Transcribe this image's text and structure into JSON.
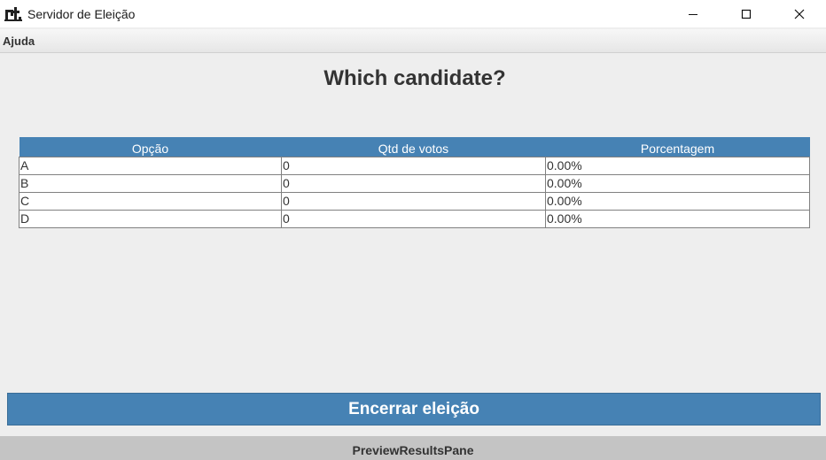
{
  "window": {
    "title": "Servidor de Eleição",
    "icon": "app-icon",
    "controls": [
      "minimize-icon",
      "maximize-icon",
      "close-icon"
    ]
  },
  "menu": {
    "items": [
      {
        "label": "Ajuda"
      }
    ]
  },
  "heading": "Which candidate?",
  "table": {
    "headers": [
      "Opção",
      "Qtd de votos",
      "Porcentagem"
    ],
    "rows": [
      {
        "option": "A",
        "votes": "0",
        "percent": "0.00%"
      },
      {
        "option": "B",
        "votes": "0",
        "percent": "0.00%"
      },
      {
        "option": "C",
        "votes": "0",
        "percent": "0.00%"
      },
      {
        "option": "D",
        "votes": "0",
        "percent": "0.00%"
      }
    ]
  },
  "end_button_label": "Encerrar eleição",
  "footer_label": "PreviewResultsPane",
  "colors": {
    "accent": "#4682b4",
    "background": "#eeeeee",
    "footer": "#c4c4c4"
  }
}
